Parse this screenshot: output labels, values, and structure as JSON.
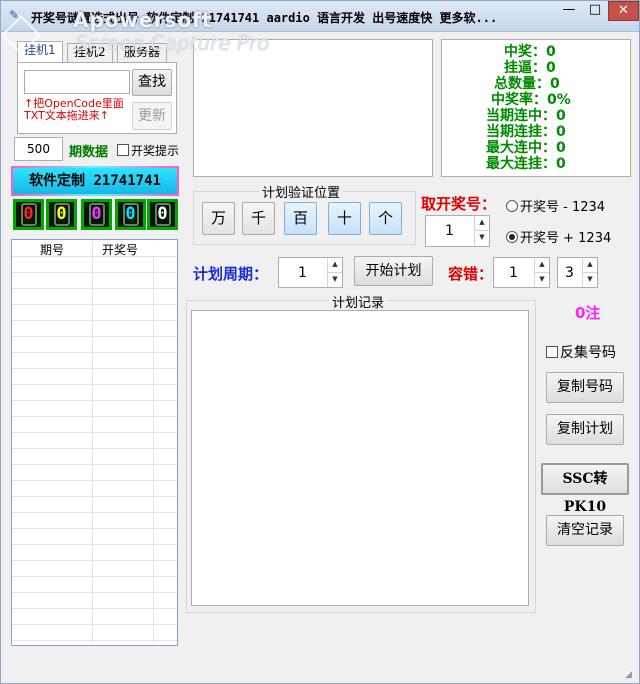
{
  "window": {
    "title": "开奖号谜置选式出号  软件定制 21741741 aardio 语言开发 出号速度快 更多软...",
    "watermark_brand": "Apowersoft",
    "watermark_product": "Screen Capture Pro",
    "minimize": "—",
    "maximize": "□",
    "close": "✕"
  },
  "left": {
    "tabs": [
      "挂机1",
      "挂机2",
      "服务器"
    ],
    "search_button": "查找",
    "hint_line1": "↑把OpenCode里面",
    "hint_line2": "TXT文本拖进来↑",
    "update_button": "更新",
    "period_count": "500",
    "period_count_label": "期数据",
    "prize_alert_label": "开奖提示",
    "brand_banner": "软件定制  21741741",
    "digits": [
      "0",
      "0",
      "0",
      "0",
      "0"
    ],
    "digit_colors": [
      "#ff2020",
      "#ffff00",
      "#ff30ff",
      "#00e0ff",
      "#ffffff"
    ],
    "table_headers": [
      "期号",
      "开奖号"
    ]
  },
  "stats": {
    "lines": [
      {
        "label": "中奖：",
        "value": "0"
      },
      {
        "label": "挂逼：",
        "value": "0"
      },
      {
        "label": "总数量：",
        "value": "0"
      },
      {
        "label": "中奖率：",
        "value": "0%"
      },
      {
        "label": "当期连中：",
        "value": "0"
      },
      {
        "label": "当期连挂：",
        "value": "0"
      },
      {
        "label": "最大连中：",
        "value": "0"
      },
      {
        "label": "最大连挂：",
        "value": "0"
      }
    ]
  },
  "verify": {
    "title": "计划验证位置",
    "positions": [
      "万",
      "千",
      "百",
      "十",
      "个"
    ],
    "active": [
      false,
      false,
      true,
      true,
      true
    ]
  },
  "draw": {
    "label": "取开奖号：",
    "value": "1",
    "option_minus": "开奖号 - 1234",
    "option_plus": "开奖号 + 1234",
    "selected": "plus"
  },
  "plan": {
    "period_label": "计划周期：",
    "period_value": "1",
    "start_button": "开始计划",
    "tolerance_label": "容错：",
    "tolerance_value1": "1",
    "tolerance_value2": "3",
    "record_title": "计划记录",
    "count_text": "0注"
  },
  "actions": {
    "reverse_label": "反集号码",
    "copy_numbers": "复制号码",
    "copy_plan": "复制计划",
    "ssc_to_pk10": "SSC转PK10",
    "clear_records": "清空记录"
  }
}
